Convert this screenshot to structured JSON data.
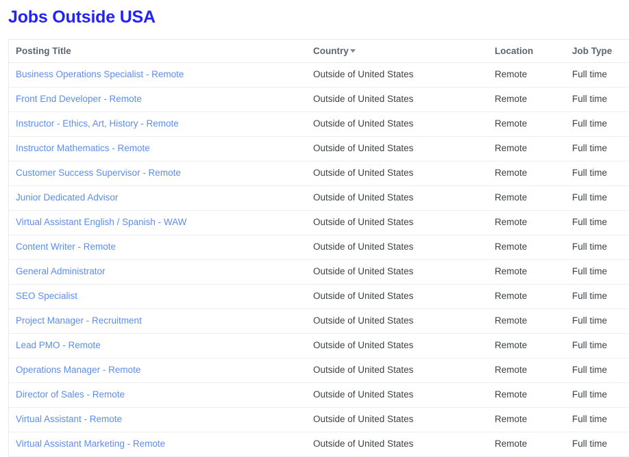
{
  "page": {
    "title": "Jobs Outside USA",
    "title_color": "#2222ff",
    "link_color": "#5b8def",
    "header_text_color": "#5b6670",
    "cell_text_color": "#3c4043",
    "row_divider_color": "#eceef0"
  },
  "table": {
    "columns": [
      {
        "key": "posting_title",
        "label": "Posting Title",
        "sortable": true,
        "sort_indicator": null
      },
      {
        "key": "country",
        "label": "Country",
        "sortable": true,
        "sort_indicator": "caret-down-icon"
      },
      {
        "key": "location",
        "label": "Location",
        "sortable": true,
        "sort_indicator": null
      },
      {
        "key": "job_type",
        "label": "Job Type",
        "sortable": true,
        "sort_indicator": null
      }
    ],
    "rows": [
      {
        "posting_title": "Business Operations Specialist - Remote",
        "country": "Outside of United States",
        "location": "Remote",
        "job_type": "Full time"
      },
      {
        "posting_title": "Front End Developer - Remote",
        "country": "Outside of United States",
        "location": "Remote",
        "job_type": "Full time"
      },
      {
        "posting_title": "Instructor - Ethics, Art, History - Remote",
        "country": "Outside of United States",
        "location": "Remote",
        "job_type": "Full time"
      },
      {
        "posting_title": "Instructor Mathematics - Remote",
        "country": "Outside of United States",
        "location": "Remote",
        "job_type": "Full time"
      },
      {
        "posting_title": "Customer Success Supervisor - Remote",
        "country": "Outside of United States",
        "location": "Remote",
        "job_type": "Full time"
      },
      {
        "posting_title": "Junior Dedicated Advisor",
        "country": "Outside of United States",
        "location": "Remote",
        "job_type": "Full time"
      },
      {
        "posting_title": "Virtual Assistant English / Spanish - WAW",
        "country": "Outside of United States",
        "location": "Remote",
        "job_type": "Full time"
      },
      {
        "posting_title": "Content Writer - Remote",
        "country": "Outside of United States",
        "location": "Remote",
        "job_type": "Full time"
      },
      {
        "posting_title": "General Administrator",
        "country": "Outside of United States",
        "location": "Remote",
        "job_type": "Full time"
      },
      {
        "posting_title": "SEO Specialist",
        "country": "Outside of United States",
        "location": "Remote",
        "job_type": "Full time"
      },
      {
        "posting_title": "Project Manager - Recruitment",
        "country": "Outside of United States",
        "location": "Remote",
        "job_type": "Full time"
      },
      {
        "posting_title": "Lead PMO - Remote",
        "country": "Outside of United States",
        "location": "Remote",
        "job_type": "Full time"
      },
      {
        "posting_title": "Operations Manager - Remote",
        "country": "Outside of United States",
        "location": "Remote",
        "job_type": "Full time"
      },
      {
        "posting_title": "Director of Sales - Remote",
        "country": "Outside of United States",
        "location": "Remote",
        "job_type": "Full time"
      },
      {
        "posting_title": "Virtual Assistant - Remote",
        "country": "Outside of United States",
        "location": "Remote",
        "job_type": "Full time"
      },
      {
        "posting_title": "Virtual Assistant Marketing - Remote",
        "country": "Outside of United States",
        "location": "Remote",
        "job_type": "Full time"
      }
    ]
  }
}
